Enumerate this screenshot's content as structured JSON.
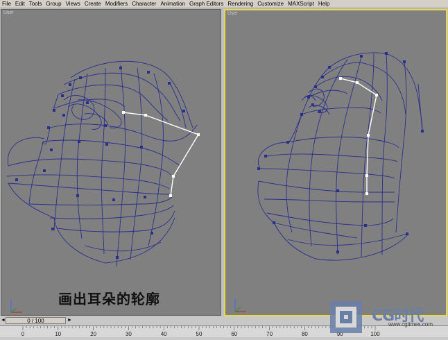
{
  "menu": [
    "File",
    "Edit",
    "Tools",
    "Group",
    "Views",
    "Create",
    "Modifiers",
    "Character",
    "Animation",
    "Graph Editors",
    "Rendering",
    "Customize",
    "MAXScript",
    "Help"
  ],
  "viewports": {
    "left": {
      "label": "User"
    },
    "right": {
      "label": "User"
    }
  },
  "caption": "画出耳朵的轮廓",
  "timeline": {
    "slider_text": "0 / 100",
    "ticks": [
      "0",
      "10",
      "20",
      "30",
      "40",
      "50",
      "60",
      "70",
      "80",
      "90",
      "100"
    ]
  },
  "watermark": {
    "brand": "CG时代",
    "url": "www.cgtimes.com"
  },
  "colors": {
    "viewport_bg": "#808080",
    "wire": "#2a2f8c",
    "selected_edge": "#ffffff",
    "active_border": "#e6d94a"
  },
  "icons": [
    "axis-tripod-icon",
    "prev-frame-icon",
    "next-frame-icon",
    "cg-logo-icon"
  ]
}
